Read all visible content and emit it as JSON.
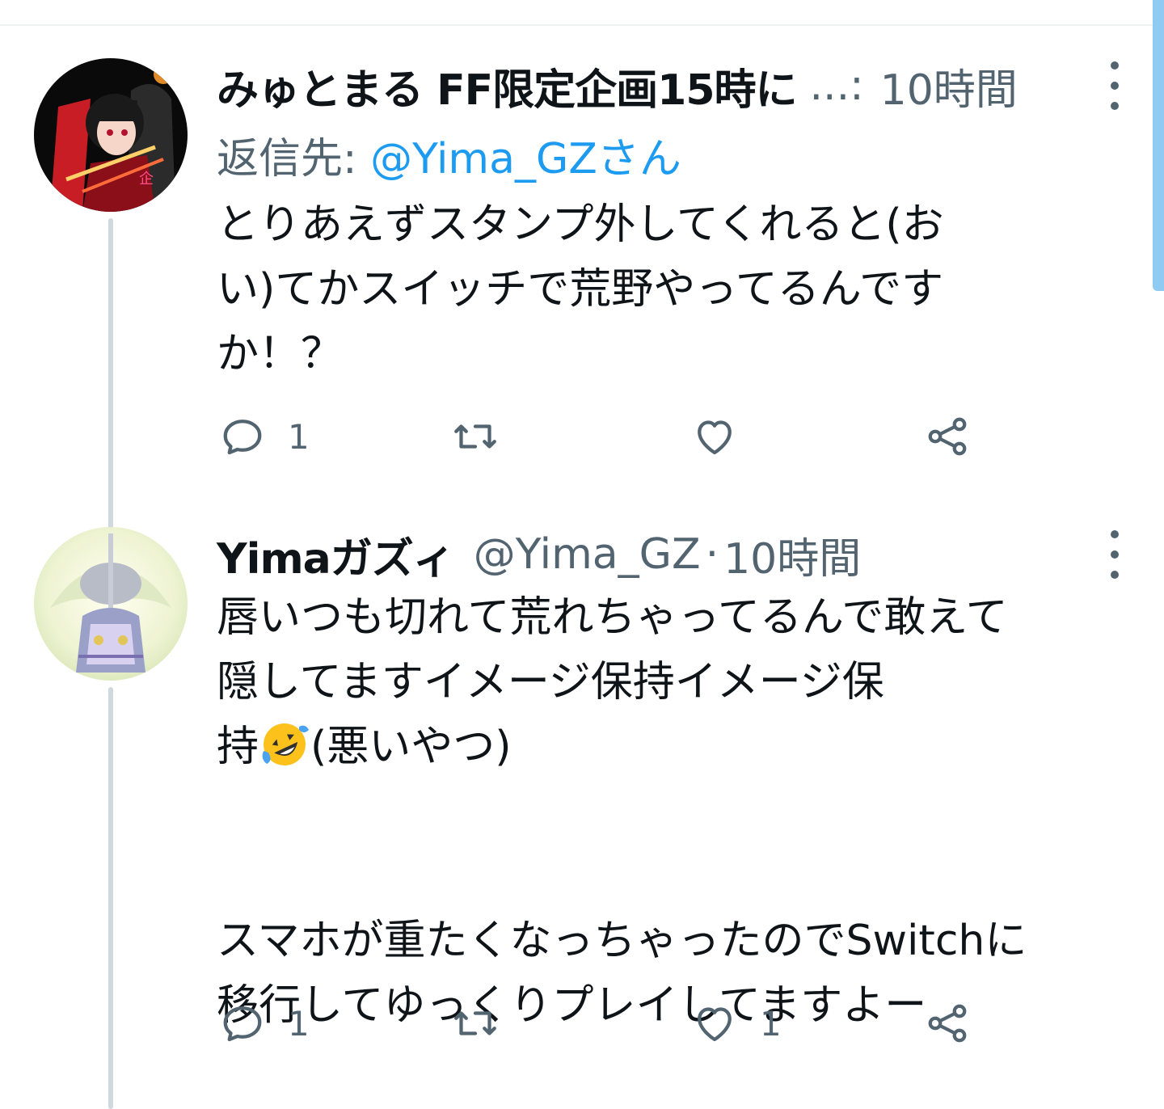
{
  "tweets": [
    {
      "display_name": "みゅとまる FF限定企画15時に",
      "ellipsis": "...:",
      "time": "10時間",
      "reply_to_label": "返信先: ",
      "reply_to_handle": "@Yima_GZさん",
      "text": "とりあえずスタンプ外してくれると(お\nい)てかスイッチで荒野やってるんです\nか！？",
      "reply_count": "1",
      "retweet_count": "",
      "like_count": "",
      "avatar_icon": "anime-girl-avatar"
    },
    {
      "display_name": "Yimaガズィ",
      "handle": "@Yima_GZ",
      "separator": "·",
      "time": "10時間",
      "text_part1": "唇いつも切れて荒れちゃってるんで敢えて\n隠してますイメージ保持イメージ保\n持",
      "text_part2": "(悪いやつ)\n\n\nスマホが重たくなっちゃったのでSwitchに\n移行してゆっくりプレイしてますよー",
      "emoji": "rolling-on-floor-laughing",
      "reply_count": "1",
      "retweet_count": "",
      "like_count": "1",
      "avatar_icon": "knight-avatar"
    }
  ],
  "colors": {
    "text_primary": "#0f1419",
    "text_secondary": "#536471",
    "link": "#1d9bf0",
    "thread_line": "#cfd9de",
    "scrollbar": "#8fcaf3"
  }
}
